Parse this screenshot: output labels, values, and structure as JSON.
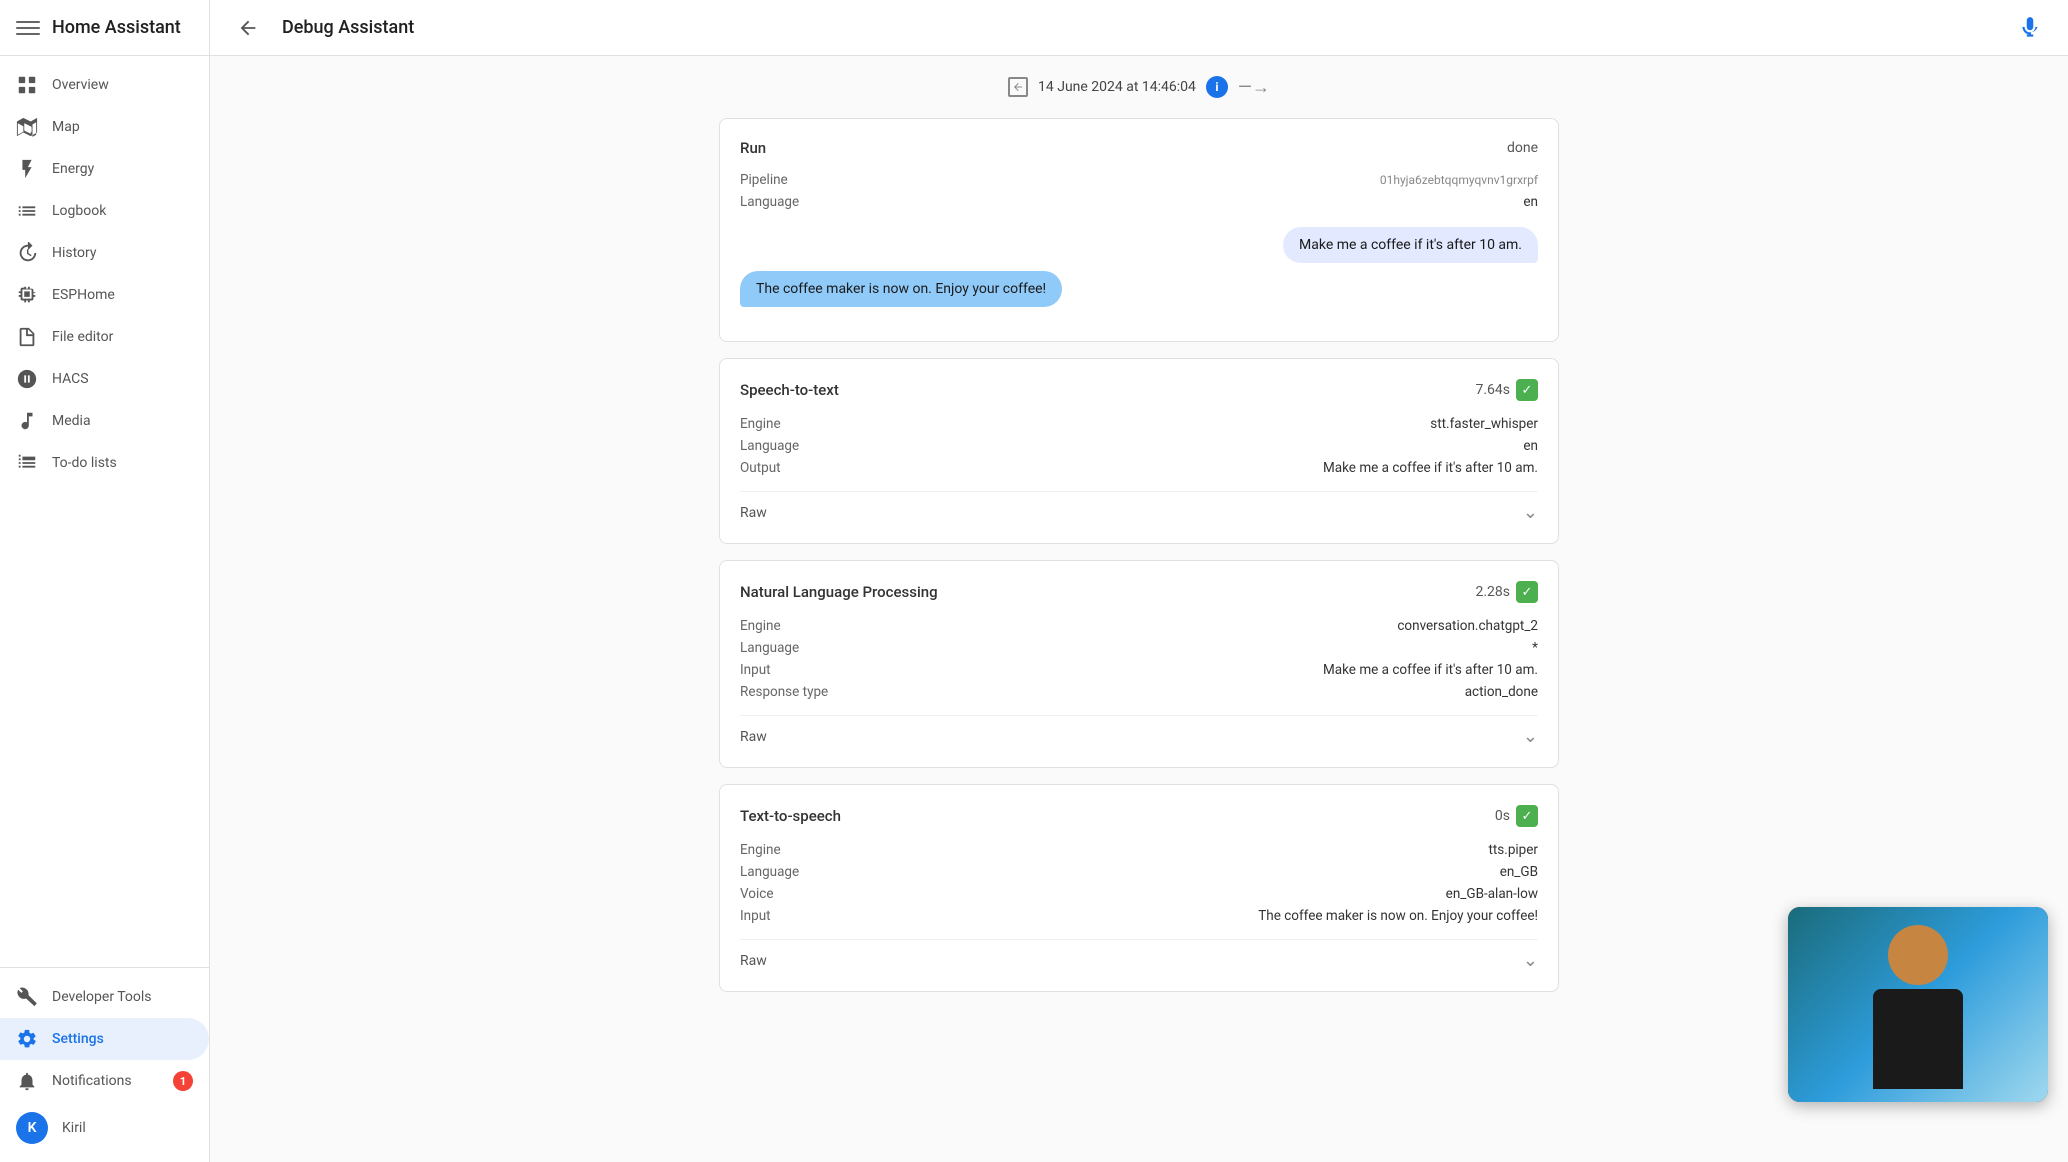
{
  "app": {
    "title": "Home Assistant"
  },
  "topbar": {
    "title": "Debug Assistant"
  },
  "timeline": {
    "date": "14 June 2024 at 14:46:04"
  },
  "sidebar": {
    "items": [
      {
        "id": "overview",
        "label": "Overview",
        "icon": "grid"
      },
      {
        "id": "map",
        "label": "Map",
        "icon": "map"
      },
      {
        "id": "energy",
        "label": "Energy",
        "icon": "bolt"
      },
      {
        "id": "logbook",
        "label": "Logbook",
        "icon": "list"
      },
      {
        "id": "history",
        "label": "History",
        "icon": "chart"
      },
      {
        "id": "esphome",
        "label": "ESPHome",
        "icon": "cpu"
      },
      {
        "id": "file-editor",
        "label": "File editor",
        "icon": "file"
      },
      {
        "id": "hacs",
        "label": "HACS",
        "icon": "hacs"
      },
      {
        "id": "media",
        "label": "Media",
        "icon": "music"
      },
      {
        "id": "todo",
        "label": "To-do lists",
        "icon": "check-list"
      }
    ],
    "bottom": [
      {
        "id": "developer-tools",
        "label": "Developer Tools",
        "icon": "tools"
      },
      {
        "id": "settings",
        "label": "Settings",
        "icon": "settings",
        "active": true
      }
    ],
    "notifications": {
      "label": "Notifications",
      "badge": "1"
    },
    "user": {
      "initial": "K",
      "name": "Kiril"
    }
  },
  "run_card": {
    "title": "Run",
    "status": "done",
    "pipeline_label": "Pipeline",
    "pipeline_value": "01hyja6zebtqqmyqvnv1grxrpf",
    "language_label": "Language",
    "language_value": "en",
    "bubble_user": "Make me a coffee if it's after 10 am.",
    "bubble_assistant": "The coffee maker is now on. Enjoy your coffee!"
  },
  "stt_card": {
    "title": "Speech-to-text",
    "timing": "7.64s",
    "engine_label": "Engine",
    "engine_value": "stt.faster_whisper",
    "language_label": "Language",
    "language_value": "en",
    "output_label": "Output",
    "output_value": "Make me a coffee if it's after 10 am.",
    "raw_label": "Raw",
    "has_check": true
  },
  "nlp_card": {
    "title": "Natural Language Processing",
    "timing": "2.28s",
    "engine_label": "Engine",
    "engine_value": "conversation.chatgpt_2",
    "language_label": "Language",
    "language_value": "*",
    "input_label": "Input",
    "input_value": "Make me a coffee if it's after 10 am.",
    "response_type_label": "Response type",
    "response_type_value": "action_done",
    "raw_label": "Raw",
    "has_check": true
  },
  "tts_card": {
    "title": "Text-to-speech",
    "timing": "0s",
    "engine_label": "Engine",
    "engine_value": "tts.piper",
    "language_label": "Language",
    "language_value": "en_GB",
    "voice_label": "Voice",
    "voice_value": "en_GB-alan-low",
    "input_label": "Input",
    "input_value": "The coffee maker is now on. Enjoy your coffee!",
    "raw_label": "Raw",
    "has_check": true
  }
}
